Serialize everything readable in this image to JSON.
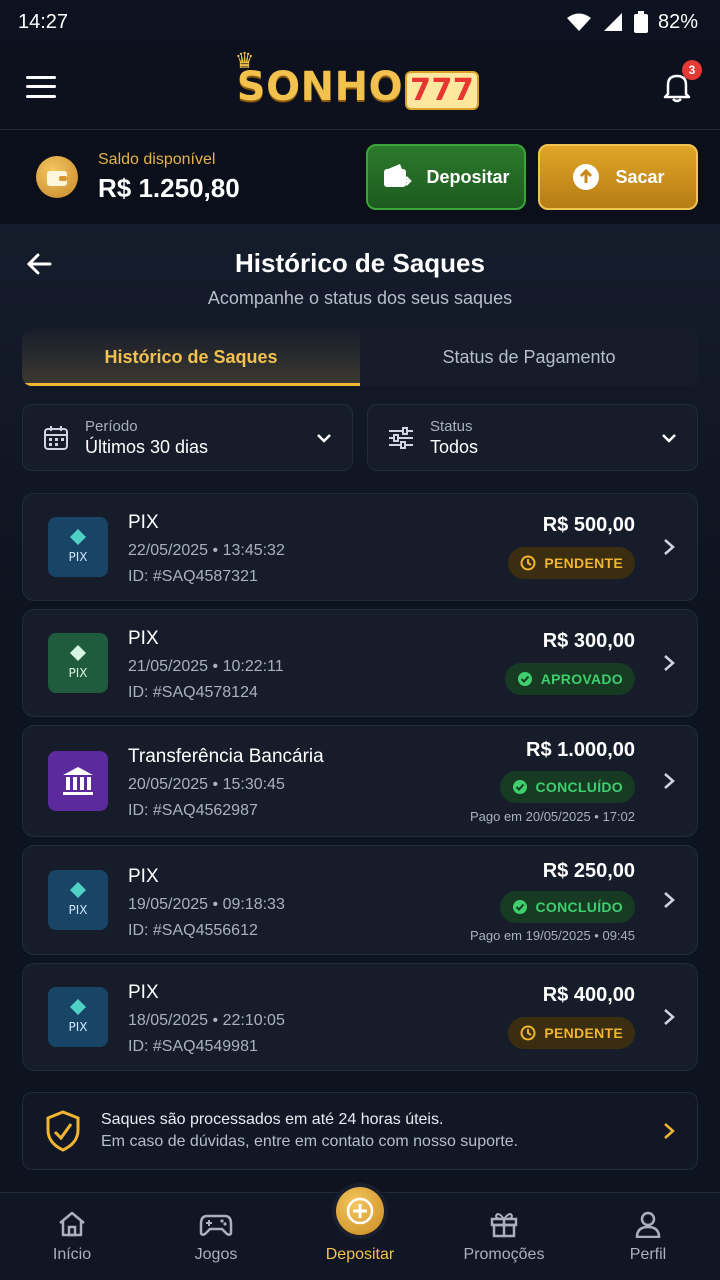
{
  "status_bar": {
    "time": "14:27",
    "battery": "82%"
  },
  "header": {
    "logo_main": "SONHO",
    "logo_num": "777",
    "notif_count": "3"
  },
  "balance": {
    "label": "Saldo disponível",
    "value": "R$ 1.250,80",
    "deposit_label": "Depositar",
    "withdraw_label": "Sacar"
  },
  "page": {
    "title": "Histórico de Saques",
    "subtitle": "Acompanhe o status dos seus saques"
  },
  "tabs": [
    {
      "label": "Histórico de Saques",
      "active": true
    },
    {
      "label": "Status de Pagamento",
      "active": false
    }
  ],
  "filters": {
    "period": {
      "label": "Período",
      "value": "Últimos 30 dias"
    },
    "status": {
      "label": "Status",
      "value": "Todos"
    }
  },
  "transactions": [
    {
      "method": "PIX",
      "date": "22/05/2025 • 13:45:32",
      "id": "ID: #SAQ4587321",
      "amount": "R$ 500,00",
      "status": "PENDENTE",
      "paid": ""
    },
    {
      "method": "PIX",
      "date": "21/05/2025 • 10:22:11",
      "id": "ID: #SAQ4578124",
      "amount": "R$ 300,00",
      "status": "APROVADO",
      "paid": ""
    },
    {
      "method": "Transferência Bancária",
      "date": "20/05/2025 • 15:30:45",
      "id": "ID: #SAQ4562987",
      "amount": "R$ 1.000,00",
      "status": "CONCLUÍDO",
      "paid": "Pago em 20/05/2025 • 17:02"
    },
    {
      "method": "PIX",
      "date": "19/05/2025 • 09:18:33",
      "id": "ID: #SAQ4556612",
      "amount": "R$ 250,00",
      "status": "CONCLUÍDO",
      "paid": "Pago em 19/05/2025 • 09:45"
    },
    {
      "method": "PIX",
      "date": "18/05/2025 • 22:10:05",
      "id": "ID: #SAQ4549981",
      "amount": "R$ 400,00",
      "status": "PENDENTE",
      "paid": ""
    }
  ],
  "notice": {
    "line1": "Saques são processados em até 24 horas úteis.",
    "line2": "Em caso de dúvidas, entre em contato com nosso suporte."
  },
  "nav": [
    {
      "label": "Início",
      "icon": "home-icon"
    },
    {
      "label": "Jogos",
      "icon": "gamepad-icon"
    },
    {
      "label": "Depositar",
      "icon": "plus-circle-icon"
    },
    {
      "label": "Promoções",
      "icon": "gift-icon"
    },
    {
      "label": "Perfil",
      "icon": "user-icon"
    }
  ],
  "colors": {
    "accent": "#f2b531",
    "success": "#3fcf6e",
    "pending": "#f2b531",
    "background": "#0d1220"
  },
  "pix_mark": "PIX"
}
